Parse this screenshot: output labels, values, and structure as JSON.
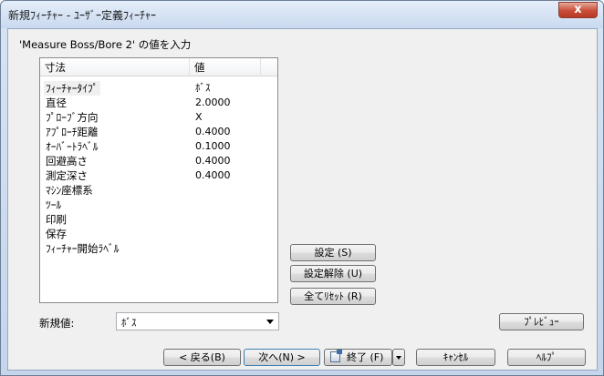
{
  "window": {
    "title": "新規ﾌｨｰﾁｬｰ - ﾕｰｻﾞｰ定義ﾌｨｰﾁｬｰ",
    "close_glyph": "x"
  },
  "prompt": "'Measure Boss/Bore 2' の値を入力",
  "grid": {
    "headers": {
      "name": "寸法",
      "value": "値"
    },
    "rows": [
      {
        "name": "ﾌｨｰﾁｬｰﾀｲﾌﾟ",
        "value": "ﾎﾞｽ"
      },
      {
        "name": "直径",
        "value": "2.0000"
      },
      {
        "name": "ﾌﾟﾛｰﾌﾞ方向",
        "value": "X"
      },
      {
        "name": "ｱﾌﾟﾛｰﾁ距離",
        "value": "0.4000"
      },
      {
        "name": "ｵｰﾊﾞｰﾄﾗﾍﾞﾙ",
        "value": "0.1000"
      },
      {
        "name": "回避高さ",
        "value": "0.4000"
      },
      {
        "name": "測定深さ",
        "value": "0.4000"
      },
      {
        "name": "ﾏｼﾝ座標系",
        "value": ""
      },
      {
        "name": "ﾂｰﾙ",
        "value": ""
      },
      {
        "name": "印刷",
        "value": ""
      },
      {
        "name": "保存",
        "value": ""
      },
      {
        "name": "ﾌｨｰﾁｬｰ開始ﾗﾍﾞﾙ",
        "value": ""
      }
    ]
  },
  "buttons": {
    "set": "設定 (S)",
    "unset": "設定解除 (U)",
    "reset_all": "全てﾘｾｯﾄ (R)",
    "preview": "ﾌﾟﾚﾋﾞｭｰ",
    "back": "< 戻る(B)",
    "next": "次へ(N) >",
    "finish": "終了 (F)",
    "cancel": "ｷｬﾝｾﾙ",
    "help": "ﾍﾙﾌﾟ"
  },
  "new_value": {
    "label": "新規値:",
    "value": "ﾎﾞｽ"
  }
}
